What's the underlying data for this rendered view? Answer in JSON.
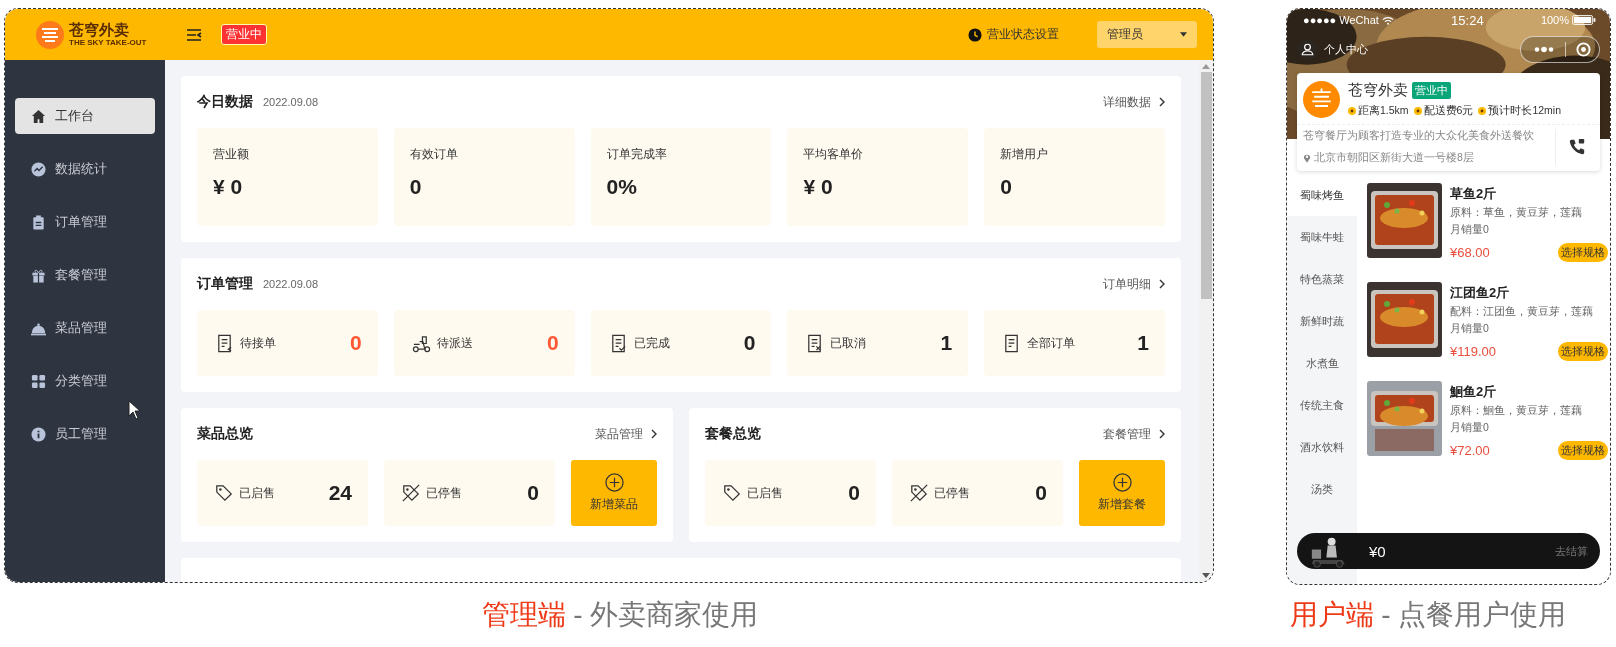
{
  "admin": {
    "logo": {
      "name": "苍穹外卖",
      "subtitle": "THE SKY TAKE-OUT"
    },
    "status_badge": "营业中",
    "status_setting": "营业状态设置",
    "user_menu": "管理员",
    "sidebar": [
      {
        "label": "工作台",
        "selected": true
      },
      {
        "label": "数据统计",
        "selected": false
      },
      {
        "label": "订单管理",
        "selected": false
      },
      {
        "label": "套餐管理",
        "selected": false
      },
      {
        "label": "菜品管理",
        "selected": false
      },
      {
        "label": "分类管理",
        "selected": false
      },
      {
        "label": "员工管理",
        "selected": false
      }
    ],
    "today": {
      "title": "今日数据",
      "date": "2022.09.08",
      "link": "详细数据",
      "stats": [
        {
          "label": "营业额",
          "value": "¥ 0"
        },
        {
          "label": "有效订单",
          "value": "0"
        },
        {
          "label": "订单完成率",
          "value": "0%"
        },
        {
          "label": "平均客单价",
          "value": "¥ 0"
        },
        {
          "label": "新增用户",
          "value": "0"
        }
      ]
    },
    "orders": {
      "title": "订单管理",
      "date": "2022.09.08",
      "link": "订单明细",
      "items": [
        {
          "label": "待接单",
          "value": "0",
          "highlight": true
        },
        {
          "label": "待派送",
          "value": "0",
          "highlight": true
        },
        {
          "label": "已完成",
          "value": "0",
          "highlight": false
        },
        {
          "label": "已取消",
          "value": "1",
          "highlight": false
        },
        {
          "label": "全部订单",
          "value": "1",
          "highlight": false
        }
      ]
    },
    "overviews": [
      {
        "title": "菜品总览",
        "link": "菜品管理",
        "items": [
          {
            "label": "已启售",
            "value": "24",
            "kind": "on"
          },
          {
            "label": "已停售",
            "value": "0",
            "kind": "off"
          }
        ],
        "add": "新增菜品"
      },
      {
        "title": "套餐总览",
        "link": "套餐管理",
        "items": [
          {
            "label": "已启售",
            "value": "0",
            "kind": "on"
          },
          {
            "label": "已停售",
            "value": "0",
            "kind": "off"
          }
        ],
        "add": "新增套餐"
      }
    ]
  },
  "phone": {
    "status_bar": {
      "carrier": "●●●●● WeChat",
      "time": "15:24",
      "battery": "100%"
    },
    "profile": "个人中心",
    "shop": {
      "name": "苍穹外卖",
      "badge": "营业中",
      "metas": [
        "距离1.5km",
        "配送费6元",
        "预计时长12min"
      ],
      "description": "苍穹餐厅为顾客打造专业的大众化美食外送餐饮",
      "address": "北京市朝阳区新街大道一号楼8层"
    },
    "categories": [
      {
        "label": "蜀味烤鱼",
        "selected": true
      },
      {
        "label": "蜀味牛蛙",
        "selected": false
      },
      {
        "label": "特色蒸菜",
        "selected": false
      },
      {
        "label": "新鲜时蔬",
        "selected": false
      },
      {
        "label": "水煮鱼",
        "selected": false
      },
      {
        "label": "传统主食",
        "selected": false
      },
      {
        "label": "酒水饮料",
        "selected": false
      },
      {
        "label": "汤类",
        "selected": false
      }
    ],
    "dishes": [
      {
        "name": "草鱼2斤",
        "ingredients": "原料：草鱼，黄豆芽，莲藕",
        "sales": "月销量0",
        "price": "¥68.00",
        "button": "选择规格"
      },
      {
        "name": "江团鱼2斤",
        "ingredients": "配料：江团鱼，黄豆芽，莲藕",
        "sales": "月销量0",
        "price": "¥119.00",
        "button": "选择规格"
      },
      {
        "name": "鮰鱼2斤",
        "ingredients": "原料：鮰鱼，黄豆芽，莲藕",
        "sales": "月销量0",
        "price": "¥72.00",
        "button": "选择规格"
      }
    ],
    "cart": {
      "amount": "¥0",
      "checkout": "去结算"
    }
  },
  "captions": [
    {
      "highlight": "管理端",
      "rest": " - 外卖商家使用"
    },
    {
      "highlight": "用户端",
      "rest": " - 点餐用户使用"
    }
  ]
}
